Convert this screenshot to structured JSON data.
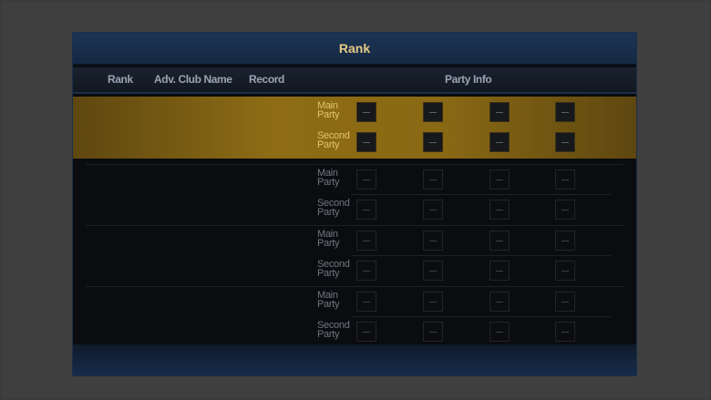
{
  "window": {
    "title": "Rank"
  },
  "columns": {
    "rank": "Rank",
    "club_name": "Adv. Club Name",
    "record": "Record",
    "party_info": "Party Info"
  },
  "rows": [
    {
      "highlighted": true,
      "main_label": "Main Party",
      "second_label": "Second Party"
    },
    {
      "highlighted": false,
      "main_label": "Main Party",
      "second_label": "Second Party"
    },
    {
      "highlighted": false,
      "main_label": "Main Party",
      "second_label": "Second Party"
    },
    {
      "highlighted": false,
      "main_label": "Main Party",
      "second_label": "Second Party"
    }
  ],
  "slot_icon": "empty-slot-dash-icon",
  "colors": {
    "title": "#e8c987",
    "highlight": "#8d6c15",
    "panel": "#0b0c0f",
    "header_bar": "#1c3454"
  }
}
